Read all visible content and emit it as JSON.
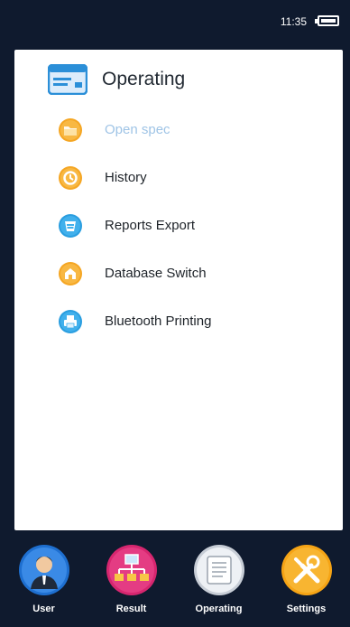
{
  "status_bar": {
    "time": "11:35",
    "battery": "battery-full"
  },
  "panel": {
    "title": "Operating",
    "header_icon": "window-icon",
    "items": [
      {
        "label": "Open spec",
        "icon": "folder-icon",
        "enabled": false,
        "color": "#f5a623"
      },
      {
        "label": "History",
        "icon": "history-icon",
        "enabled": true,
        "color": "#f5a623"
      },
      {
        "label": "Reports Export",
        "icon": "export-icon",
        "enabled": true,
        "color": "#2a9ee0"
      },
      {
        "label": "Database Switch",
        "icon": "database-switch-icon",
        "enabled": true,
        "color": "#f5a623"
      },
      {
        "label": "Bluetooth Printing",
        "icon": "printer-icon",
        "enabled": true,
        "color": "#2a9ee0"
      }
    ]
  },
  "dock": {
    "items": [
      {
        "label": "User",
        "icon": "user-icon",
        "color": "#1e6fd0"
      },
      {
        "label": "Result",
        "icon": "network-icon",
        "color": "#d6266f"
      },
      {
        "label": "Operating",
        "icon": "document-icon",
        "color": "#d8dde4"
      },
      {
        "label": "Settings",
        "icon": "tools-icon",
        "color": "#f6a415"
      }
    ]
  }
}
